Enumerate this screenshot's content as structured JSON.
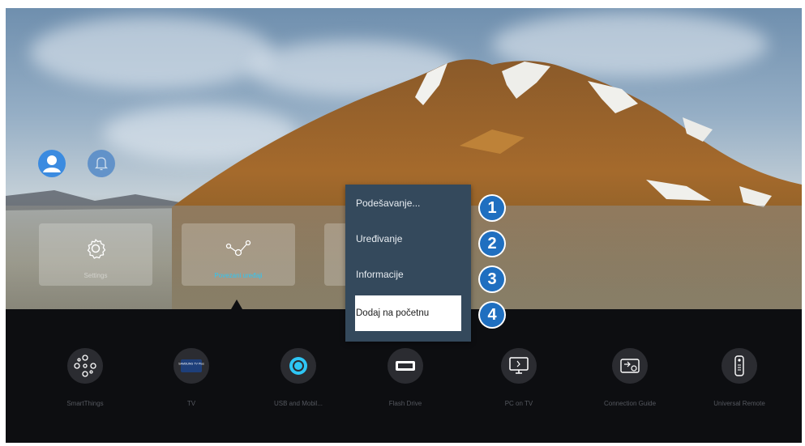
{
  "header": {
    "profile_icon": "person-icon",
    "notification_icon": "bell-icon"
  },
  "tiles": [
    {
      "label": "Settings",
      "icon": "gear-icon"
    },
    {
      "label": "Povezani uređaji",
      "icon": "connected-devices-icon"
    },
    {
      "label": "",
      "icon": "input-icon"
    }
  ],
  "context_menu": {
    "items": [
      "Podešavanje...",
      "Uređivanje",
      "Informacije",
      "Dodaj na početnu"
    ],
    "focused_index": 3
  },
  "callouts": [
    "1",
    "2",
    "3",
    "4"
  ],
  "apps": [
    {
      "label": "SmartThings",
      "icon": "smartthings-icon"
    },
    {
      "label": "TV",
      "icon": "tv-icon",
      "badge": "SAMSUNG TV Plus"
    },
    {
      "label": "USB and Mobil...",
      "icon": "usb-mobile-icon"
    },
    {
      "label": "Flash Drive",
      "icon": "flash-drive-icon"
    },
    {
      "label": "PC on TV",
      "icon": "pc-on-tv-icon"
    },
    {
      "label": "Connection Guide",
      "icon": "connection-guide-icon"
    },
    {
      "label": "Universal Remote",
      "icon": "remote-icon"
    }
  ],
  "colors": {
    "accent": "#2ec6f5",
    "menu_bg": "#34495c",
    "callout": "#1f6fc0"
  }
}
